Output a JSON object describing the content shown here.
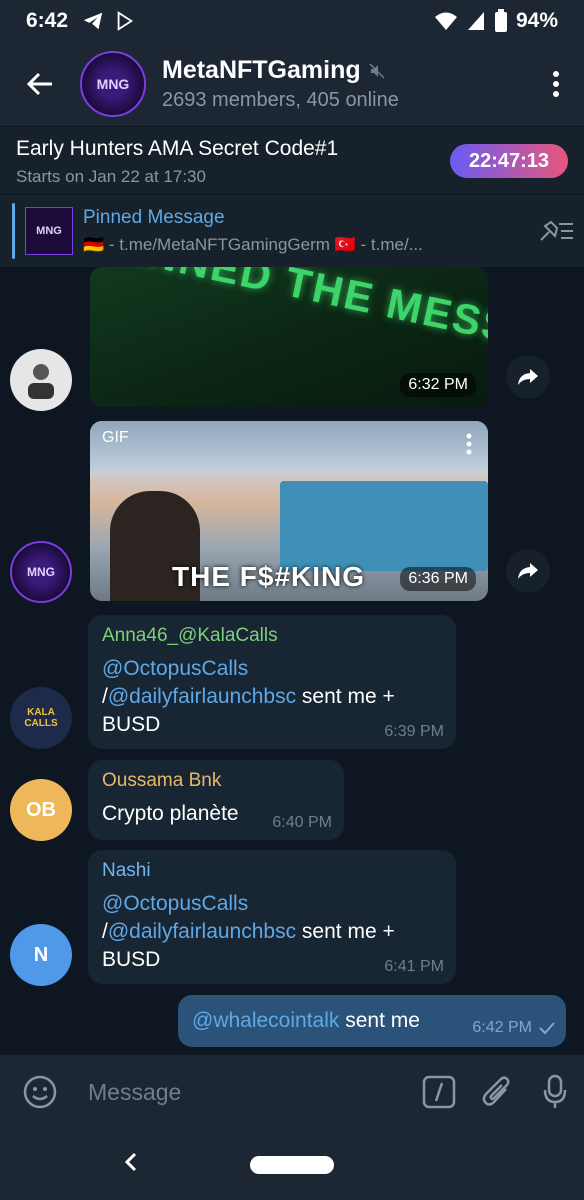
{
  "status": {
    "time": "6:42",
    "battery": "94%"
  },
  "header": {
    "title": "MetaNFTGaming",
    "subtitle": "2693 members, 405 online",
    "avatar_text": "MNG"
  },
  "event": {
    "title": "Early Hunters AMA Secret Code#1",
    "subtitle": "Starts on Jan 22 at 17:30",
    "countdown": "22:47:13"
  },
  "pinned": {
    "title": "Pinned Message",
    "text": "🇩🇪 - t.me/MetaNFTGamingGerm 🇹🇷 - t.me/..."
  },
  "media": [
    {
      "caption": "PINNED THE MESSAGE",
      "time": "6:32 PM"
    },
    {
      "badge": "GIF",
      "caption": "THE F$#KING",
      "time": "6:36 PM"
    }
  ],
  "messages": [
    {
      "sender": "Anna46_@KalaCalls",
      "sender_color": "#7ed07a",
      "mention1": "@OctopusCalls",
      "slash": "/",
      "mention2": "@dailyfairlaunchbsc",
      "rest": " sent me + BUSD",
      "time": "6:39 PM",
      "avatar_text": "KALA CALLS"
    },
    {
      "sender": "Oussama Bnk",
      "sender_color": "#e8b86a",
      "text": "Crypto planète",
      "time": "6:40 PM",
      "avatar_text": "OB",
      "avatar_color": "#eeb85a"
    },
    {
      "sender": "Nashi",
      "sender_color": "#6fb8f0",
      "mention1": "@OctopusCalls",
      "slash": "/",
      "mention2": "@dailyfairlaunchbsc",
      "rest": " sent me + BUSD",
      "time": "6:41 PM",
      "avatar_text": "N",
      "avatar_color": "#4f99e8"
    }
  ],
  "outgoing": {
    "mention": "@whalecointalk",
    "rest": " sent me",
    "time": "6:42 PM"
  },
  "input": {
    "placeholder": "Message"
  }
}
